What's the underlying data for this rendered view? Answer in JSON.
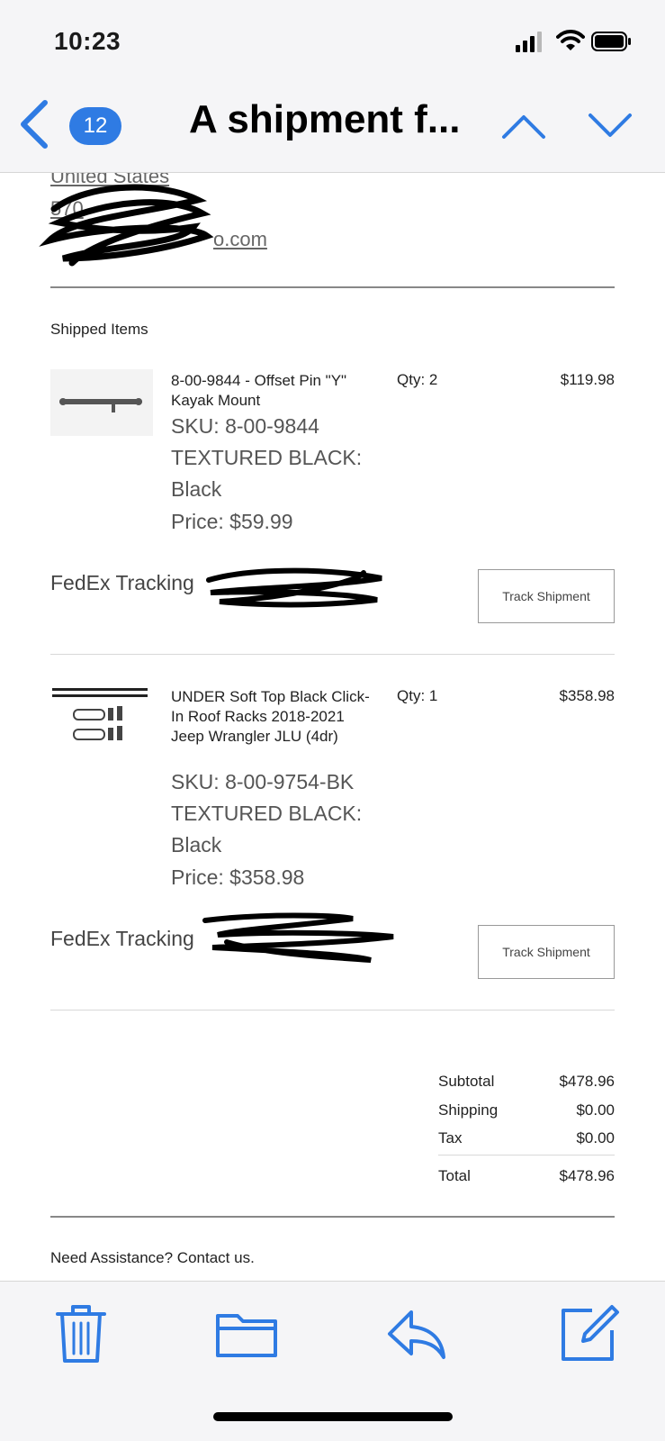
{
  "status_bar": {
    "time": "10:23"
  },
  "nav": {
    "unread_count": "12",
    "title": "A shipment f..."
  },
  "address": {
    "country": "United States",
    "phone": "570",
    "email": "o.com"
  },
  "shipped": {
    "label": "Shipped Items",
    "items": [
      {
        "title": "8-00-9844 - Offset Pin \"Y\" Kayak Mount",
        "qty": "Qty: 2",
        "price": "$119.98",
        "sku": "SKU: 8-00-9844",
        "option_a": "TEXTURED BLACK:",
        "option_b": "Black",
        "unit_price": "Price: $59.99",
        "tracking_label": "FedEx Tracking",
        "track_button": "Track Shipment"
      },
      {
        "title": "UNDER Soft Top Black Click-In Roof Racks 2018-2021 Jeep Wrangler JLU (4dr)",
        "qty": "Qty: 1",
        "price": "$358.98",
        "sku": "SKU: 8-00-9754-BK",
        "option_a": "TEXTURED BLACK:",
        "option_b": "Black",
        "unit_price": "Price: $358.98",
        "tracking_label": "FedEx Tracking",
        "track_button": "Track Shipment"
      }
    ]
  },
  "totals": {
    "subtotal_label": "Subtotal",
    "subtotal": "$478.96",
    "shipping_label": "Shipping",
    "shipping": "$0.00",
    "tax_label": "Tax",
    "tax": "$0.00",
    "total_label": "Total",
    "total": "$478.96"
  },
  "footer": {
    "assistance": "Need Assistance? Contact us."
  },
  "colors": {
    "accent": "#2f7be3",
    "chrome": "#f5f5f7"
  },
  "toolbar": {
    "icons": [
      "trash-icon",
      "folder-icon",
      "reply-icon",
      "compose-icon"
    ]
  }
}
